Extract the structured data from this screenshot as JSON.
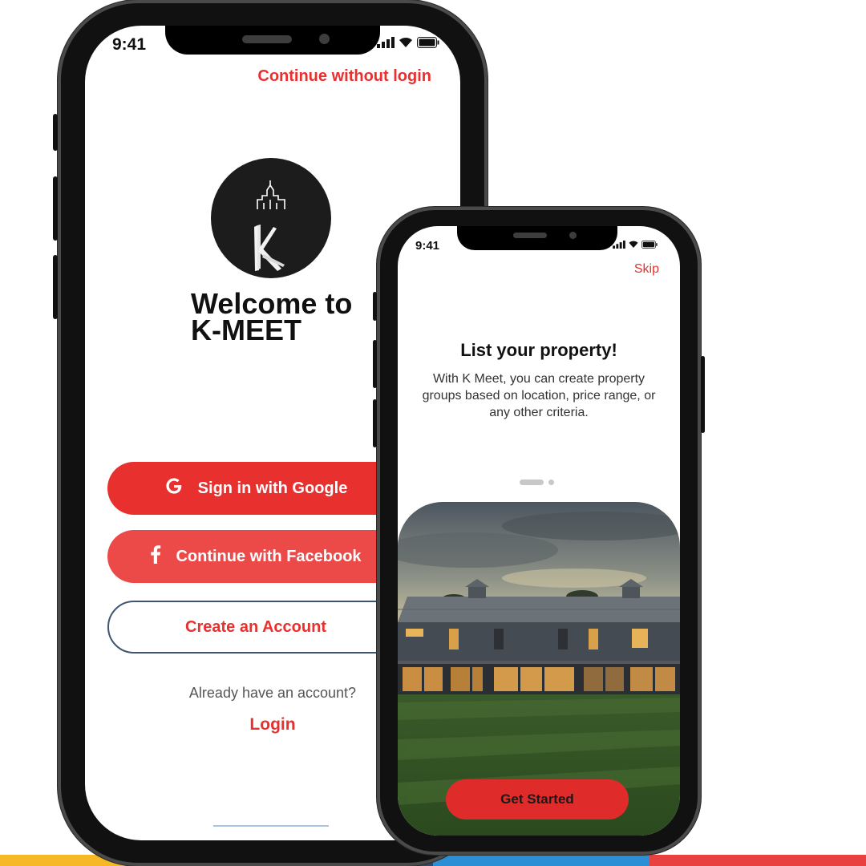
{
  "colors": {
    "accent": "#e8302f",
    "strip": [
      "#f6b826",
      "#2f4b6e",
      "#2b8fd6",
      "#e8413f"
    ]
  },
  "phone1": {
    "status_time": "9:41",
    "continue_without_login": "Continue without login",
    "logo_letter": "K",
    "welcome_line1": "Welcome to",
    "welcome_line2": "K-MEET",
    "google_icon": "google-g-icon",
    "google_label": "Sign in with Google",
    "facebook_icon": "facebook-f-icon",
    "facebook_label": "Continue with Facebook",
    "create_label": "Create an Account",
    "already_text": "Already have an account?",
    "login_label": "Login"
  },
  "phone2": {
    "status_time": "9:41",
    "skip_label": "Skip",
    "title": "List your property!",
    "description": "With K Meet, you can create property groups based on location, price range, or any other criteria.",
    "page_indicator": {
      "count": 2,
      "active_index": 0
    },
    "get_started_label": "Get Started"
  }
}
